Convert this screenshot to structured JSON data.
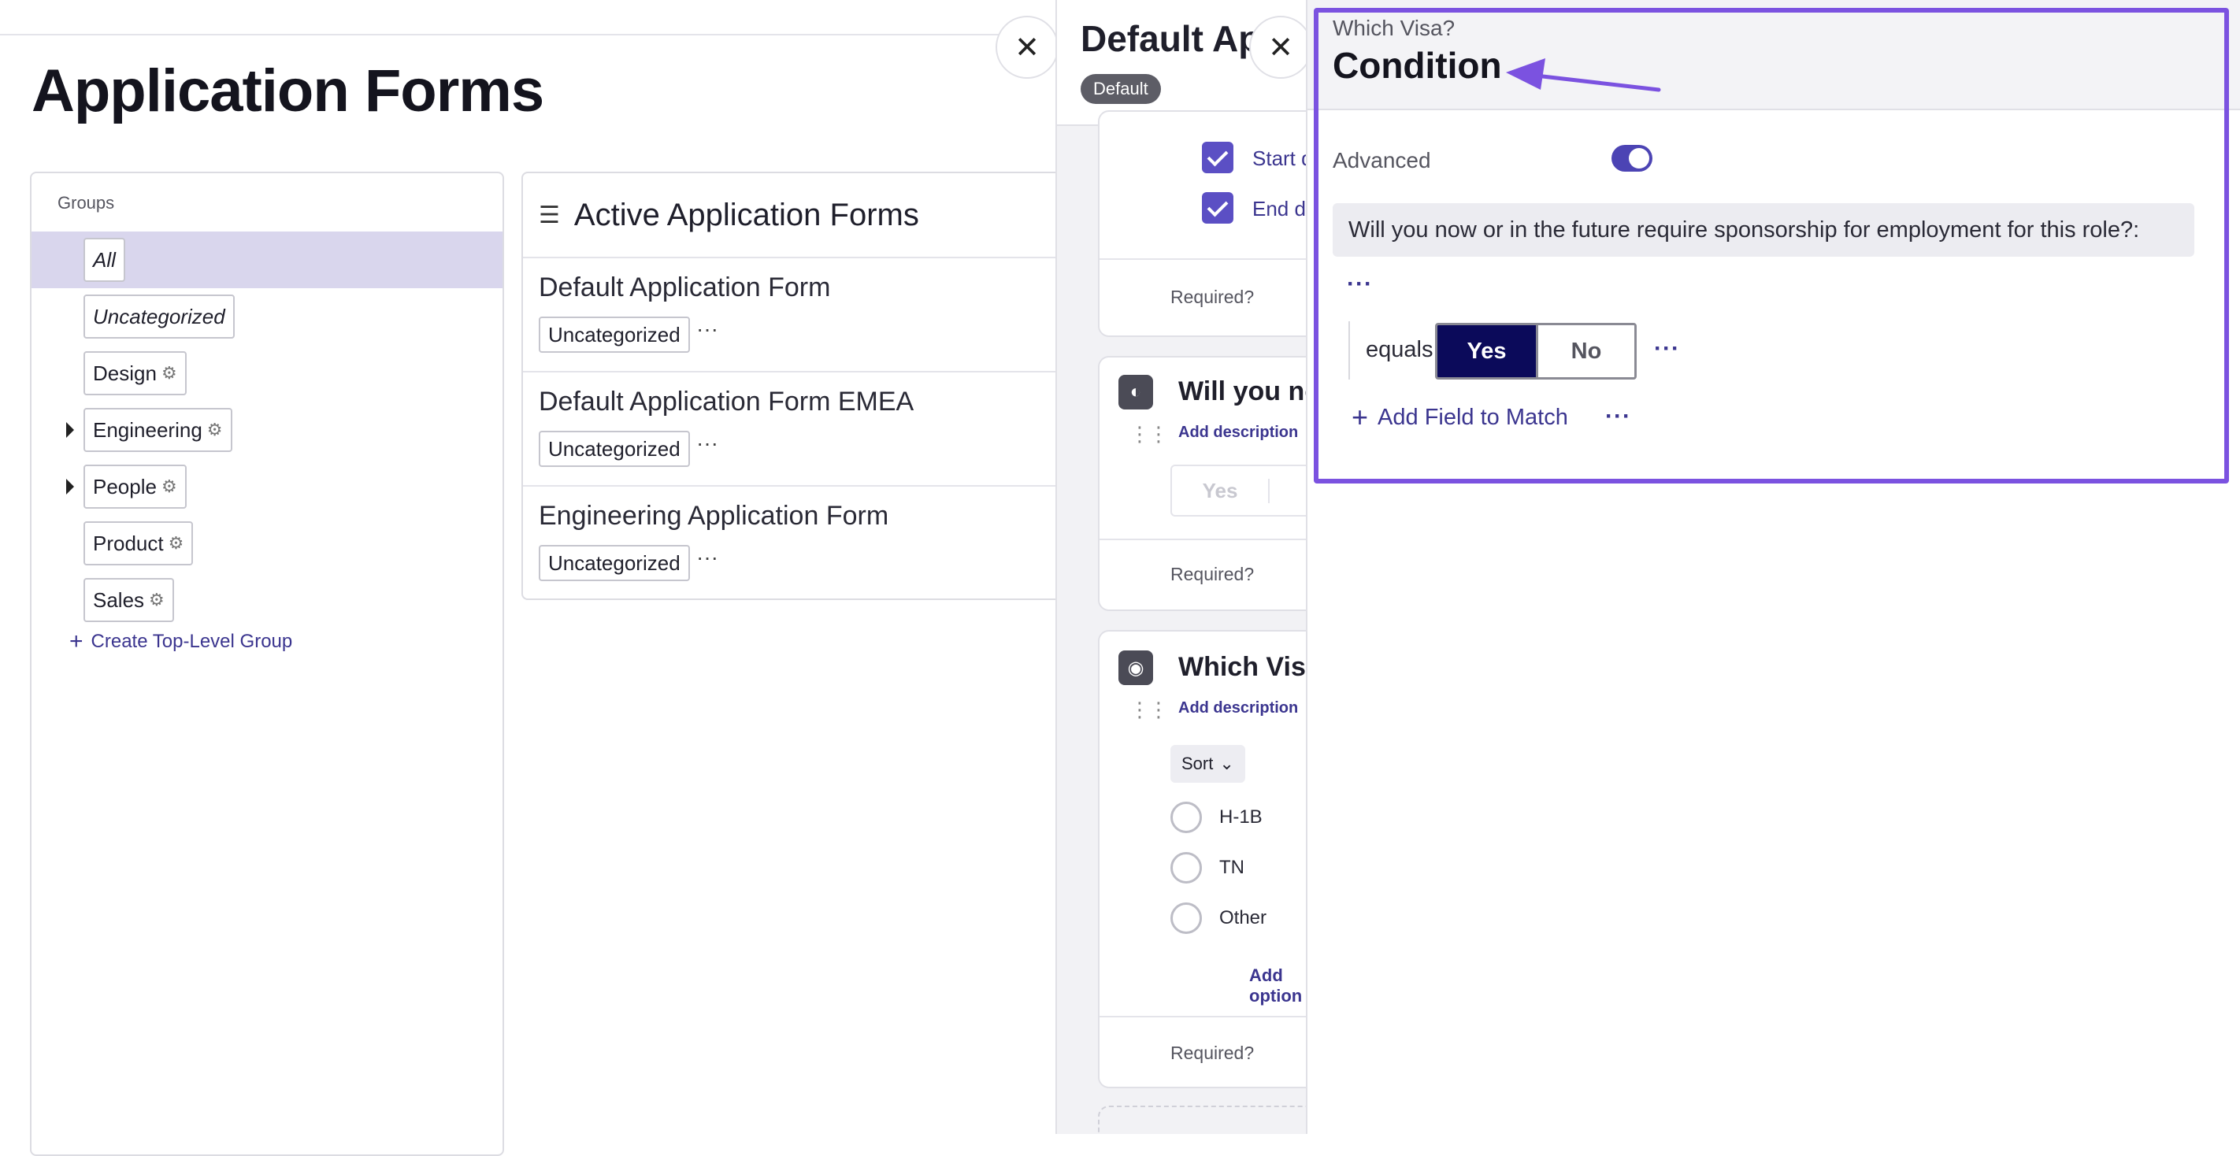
{
  "page": {
    "title": "Application Forms"
  },
  "groups": {
    "title": "Groups",
    "items": [
      {
        "label": "All"
      },
      {
        "label": "Uncategorized"
      },
      {
        "label": "Design"
      },
      {
        "label": "Engineering"
      },
      {
        "label": "People"
      },
      {
        "label": "Product"
      },
      {
        "label": "Sales"
      }
    ],
    "create_label": "Create Top-Level Group"
  },
  "forms": {
    "title": "Active Application Forms",
    "rows": [
      {
        "name": "Default Application Form",
        "tag": "Uncategorized",
        "more": "···"
      },
      {
        "name": "Default Application Form EMEA",
        "tag": "Uncategorized",
        "more": "···"
      },
      {
        "name": "Engineering Application Form",
        "tag": "Uncategorized",
        "more": "···"
      }
    ]
  },
  "drawer": {
    "title": "Default Ap",
    "badge": "Default",
    "start_label": "Start dat",
    "end_label": "End date",
    "required_label": "Required?",
    "q1": {
      "title": "Will you no",
      "add_description": "Add description",
      "yes_label": "Yes"
    },
    "q2": {
      "title": "Which Visa",
      "add_description": "Add description",
      "sort_label": "Sort",
      "options": [
        "H-1B",
        "TN",
        "Other"
      ],
      "add_option": "Add option"
    }
  },
  "condition": {
    "subtitle": "Which Visa?",
    "title": "Condition",
    "advanced_label": "Advanced",
    "advanced_on": true,
    "field_text": "Will you now or  in the future require sponsorship for employment for this role?:",
    "more": "···",
    "equals_label": "equals",
    "yes_label": "Yes",
    "no_label": "No",
    "selected": "Yes",
    "add_field_label": "Add Field to Match"
  },
  "colors": {
    "accent": "#5b4fc4",
    "highlight": "#7b52e0",
    "selected_segment": "#0b0a5a"
  }
}
